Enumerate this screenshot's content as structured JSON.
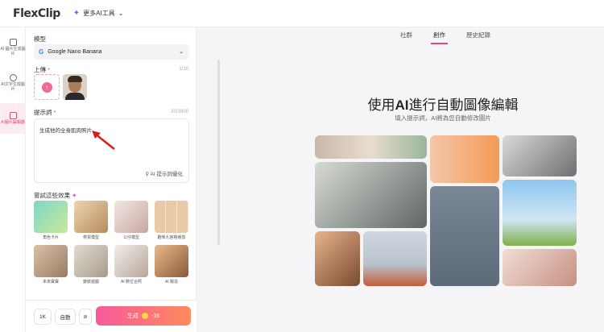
{
  "app": {
    "logo": "FlexClip",
    "ai_tools": "更多AI工具"
  },
  "rail": [
    {
      "label": "AI 圖片生成圖片"
    },
    {
      "label": "AI文字生成圖片"
    },
    {
      "label": "AI圖片編輯器"
    }
  ],
  "panel": {
    "model_label": "模型",
    "model_value": "Google Nano Banana",
    "upload_label": "上傳",
    "upload_count": "1/10",
    "prompt_label": "提示詞",
    "prompt_count": "20/3000",
    "prompt_text": "生成他的全身肌肉照片",
    "optimize": "AI 提示詞優化",
    "effects_label": "嘗試這些效果",
    "effects": [
      "角色卡片",
      "帶貨模型",
      "公仔模型",
      "趣味九宮格番茄",
      "未來寶寶",
      "變裝遊戲",
      "AI 數位合照",
      "AI 擬造"
    ]
  },
  "bottom": {
    "res": "1K",
    "auto": "自動",
    "generate": "生成",
    "cost": "-16"
  },
  "tabs": [
    "社群",
    "創作",
    "歷史紀錄"
  ],
  "hero": {
    "title_pre": "使用",
    "title_bold": "AI",
    "title_post": "進行自動圖像編輯",
    "subtitle": "填入提示詞，AI將為您自動修改圖片"
  },
  "colors": {
    "accent": "#e9457d",
    "brand": "#6a4cff"
  }
}
